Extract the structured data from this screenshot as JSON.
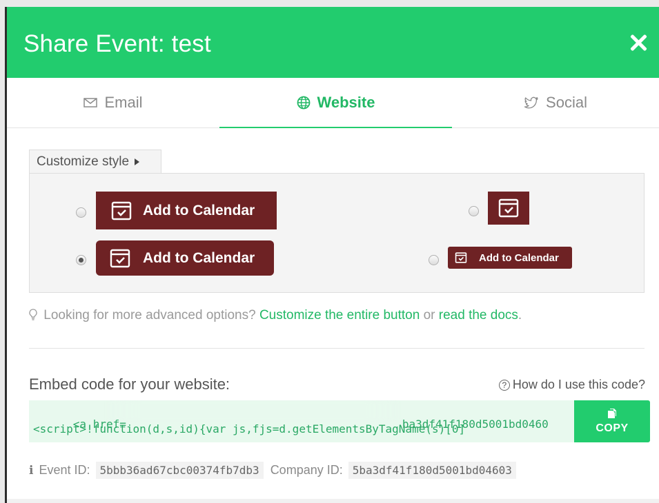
{
  "modal": {
    "title": "Share Event: test"
  },
  "tabs": [
    {
      "label": "Email",
      "icon": "envelope-icon",
      "active": false
    },
    {
      "label": "Website",
      "icon": "globe-icon",
      "active": true
    },
    {
      "label": "Social",
      "icon": "twitter-icon",
      "active": false
    }
  ],
  "customize": {
    "label": "Customize style"
  },
  "styles": {
    "button_label": "Add to Calendar",
    "selected": 2,
    "color": "#6e2224"
  },
  "hint": {
    "prefix": "Looking for more advanced options?",
    "link1": "Customize the entire button",
    "middle": "or",
    "link2": "read the docs",
    "suffix": "."
  },
  "embed": {
    "label": "Embed code for your website:",
    "howto": "How do I use this code?",
    "line1_start": "<a href=",
    "line1_end": "ba3df41f180d5001bd0460",
    "line2": "<script>!function(d,s,id){var js,fjs=d.getElementsByTagName(s)[0]",
    "copy_label": "COPY"
  },
  "ids": {
    "event_label": "Event ID:",
    "event_id": "5bbb36ad67cbc00374fb7db3",
    "company_label": "Company ID:",
    "company_id": "5ba3df41f180d5001bd04603"
  },
  "colors": {
    "accent": "#22cc6e",
    "accent_text": "#22b865",
    "calendar_button": "#6e2224"
  }
}
